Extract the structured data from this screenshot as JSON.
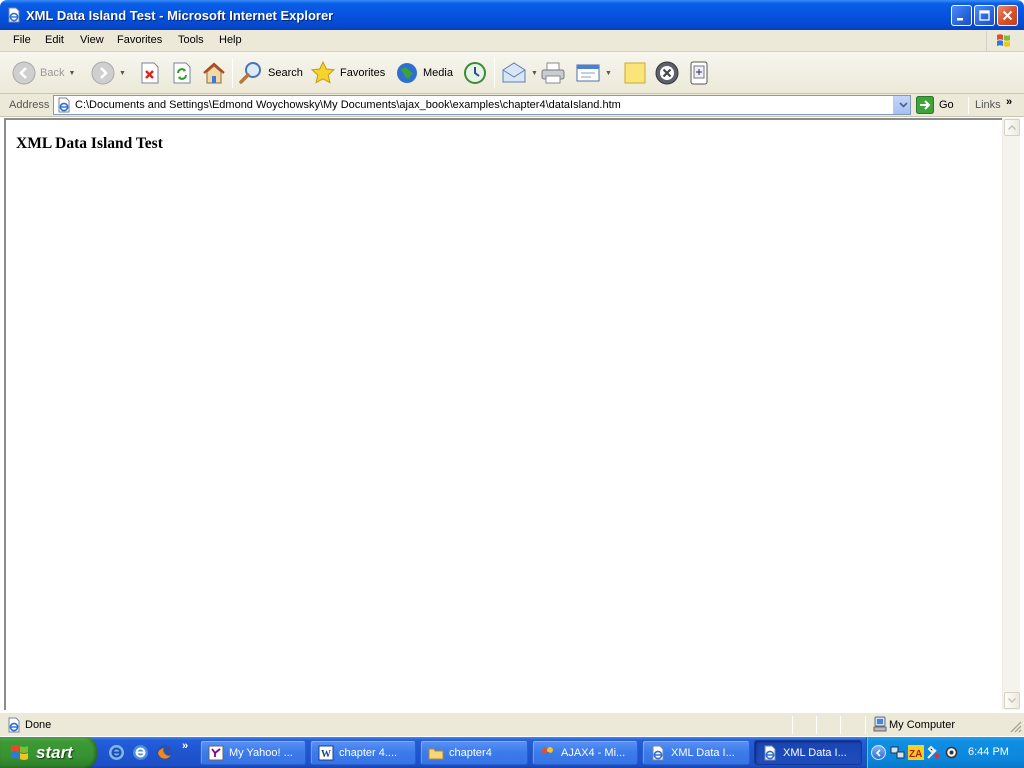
{
  "window": {
    "title": "XML Data Island Test - Microsoft Internet Explorer"
  },
  "menu": {
    "items": [
      "File",
      "Edit",
      "View",
      "Favorites",
      "Tools",
      "Help"
    ]
  },
  "toolbar": {
    "back_label": "Back",
    "search_label": "Search",
    "favorites_label": "Favorites",
    "media_label": "Media"
  },
  "address": {
    "label": "Address",
    "url": "C:\\Documents and Settings\\Edmond Woychowsky\\My Documents\\ajax_book\\examples\\chapter4\\dataIsland.htm",
    "go_label": "Go",
    "links_label": "Links"
  },
  "page": {
    "heading": "XML Data Island Test"
  },
  "status": {
    "text": "Done",
    "zone": "My Computer"
  },
  "taskbar": {
    "start_label": "start",
    "tasks": [
      {
        "label": "My Yahoo! ...",
        "icon": "yahoo-icon",
        "active": false
      },
      {
        "label": "chapter 4....",
        "icon": "word-doc-icon",
        "active": false
      },
      {
        "label": "chapter4",
        "icon": "folder-icon",
        "active": false
      },
      {
        "label": "AJAX4 - Mi...",
        "icon": "paint-icon",
        "active": false
      },
      {
        "label": "XML Data I...",
        "icon": "ie-page-icon",
        "active": false
      },
      {
        "label": "XML Data I...",
        "icon": "ie-page-icon",
        "active": true
      }
    ],
    "clock": "6:44 PM"
  },
  "colors": {
    "title_bar": "#0553df",
    "taskbar": "#1f55cf",
    "start_button": "#379332",
    "tray": "#0c87dd",
    "chrome": "#ece9d8"
  }
}
